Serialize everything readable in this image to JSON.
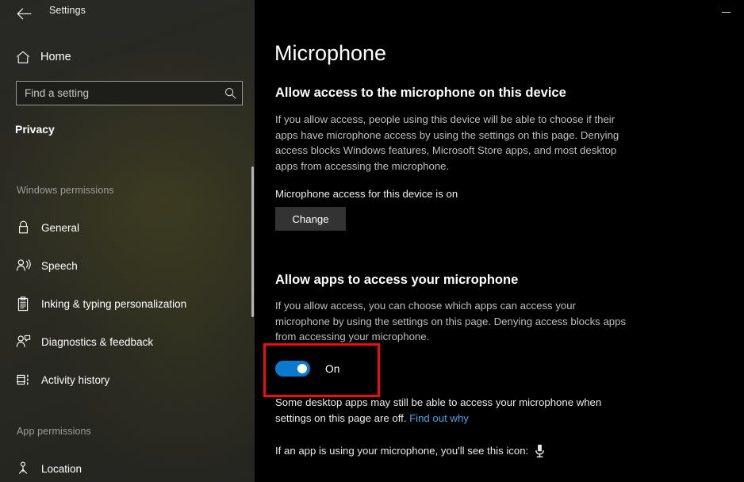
{
  "window": {
    "title": "Settings",
    "back_icon": "back-arrow-icon",
    "minimize_label": "Minimize"
  },
  "sidebar": {
    "home": {
      "label": "Home",
      "icon": "home-icon"
    },
    "search": {
      "placeholder": "Find a setting",
      "value": "",
      "icon": "search-icon"
    },
    "category_title": "Privacy",
    "groups": [
      {
        "header": "Windows permissions",
        "items": [
          {
            "label": "General",
            "icon": "lock-icon"
          },
          {
            "label": "Speech",
            "icon": "speech-person-icon"
          },
          {
            "label": "Inking & typing personalization",
            "icon": "clipboard-pen-icon"
          },
          {
            "label": "Diagnostics & feedback",
            "icon": "person-feedback-icon"
          },
          {
            "label": "Activity history",
            "icon": "activity-history-icon"
          }
        ]
      },
      {
        "header": "App permissions",
        "items": [
          {
            "label": "Location",
            "icon": "location-pin-icon"
          }
        ]
      }
    ]
  },
  "main": {
    "page_title": "Microphone",
    "sections": [
      {
        "heading": "Allow access to the microphone on this device",
        "description": "If you allow access, people using this device will be able to choose if their apps have microphone access by using the settings on this page. Denying access blocks Windows features, Microsoft Store apps, and most desktop apps from accessing the microphone.",
        "status": "Microphone access for this device is on",
        "button_label": "Change"
      },
      {
        "heading": "Allow apps to access your microphone",
        "description": "If you allow access, you can choose which apps can access your microphone by using the settings on this page. Denying access blocks apps from accessing your microphone.",
        "toggle": {
          "state": "On",
          "checked": true
        },
        "note_prefix": "Some desktop apps may still be able to access your microphone when settings on this page are off. ",
        "note_link": "Find out why",
        "icon_note": "If an app is using your microphone, you'll see this icon:",
        "icon_name": "microphone-icon"
      }
    ]
  },
  "annotation": {
    "type": "highlight-box",
    "color": "#f20b0b",
    "target": "allow-apps-microphone-toggle"
  },
  "colors": {
    "accent": "#0a7ad0",
    "link": "#4aa3e8",
    "sidebar_bg": "#2a2a22",
    "main_bg": "#000000",
    "button_bg": "#333333",
    "highlight": "#f20b0b"
  }
}
